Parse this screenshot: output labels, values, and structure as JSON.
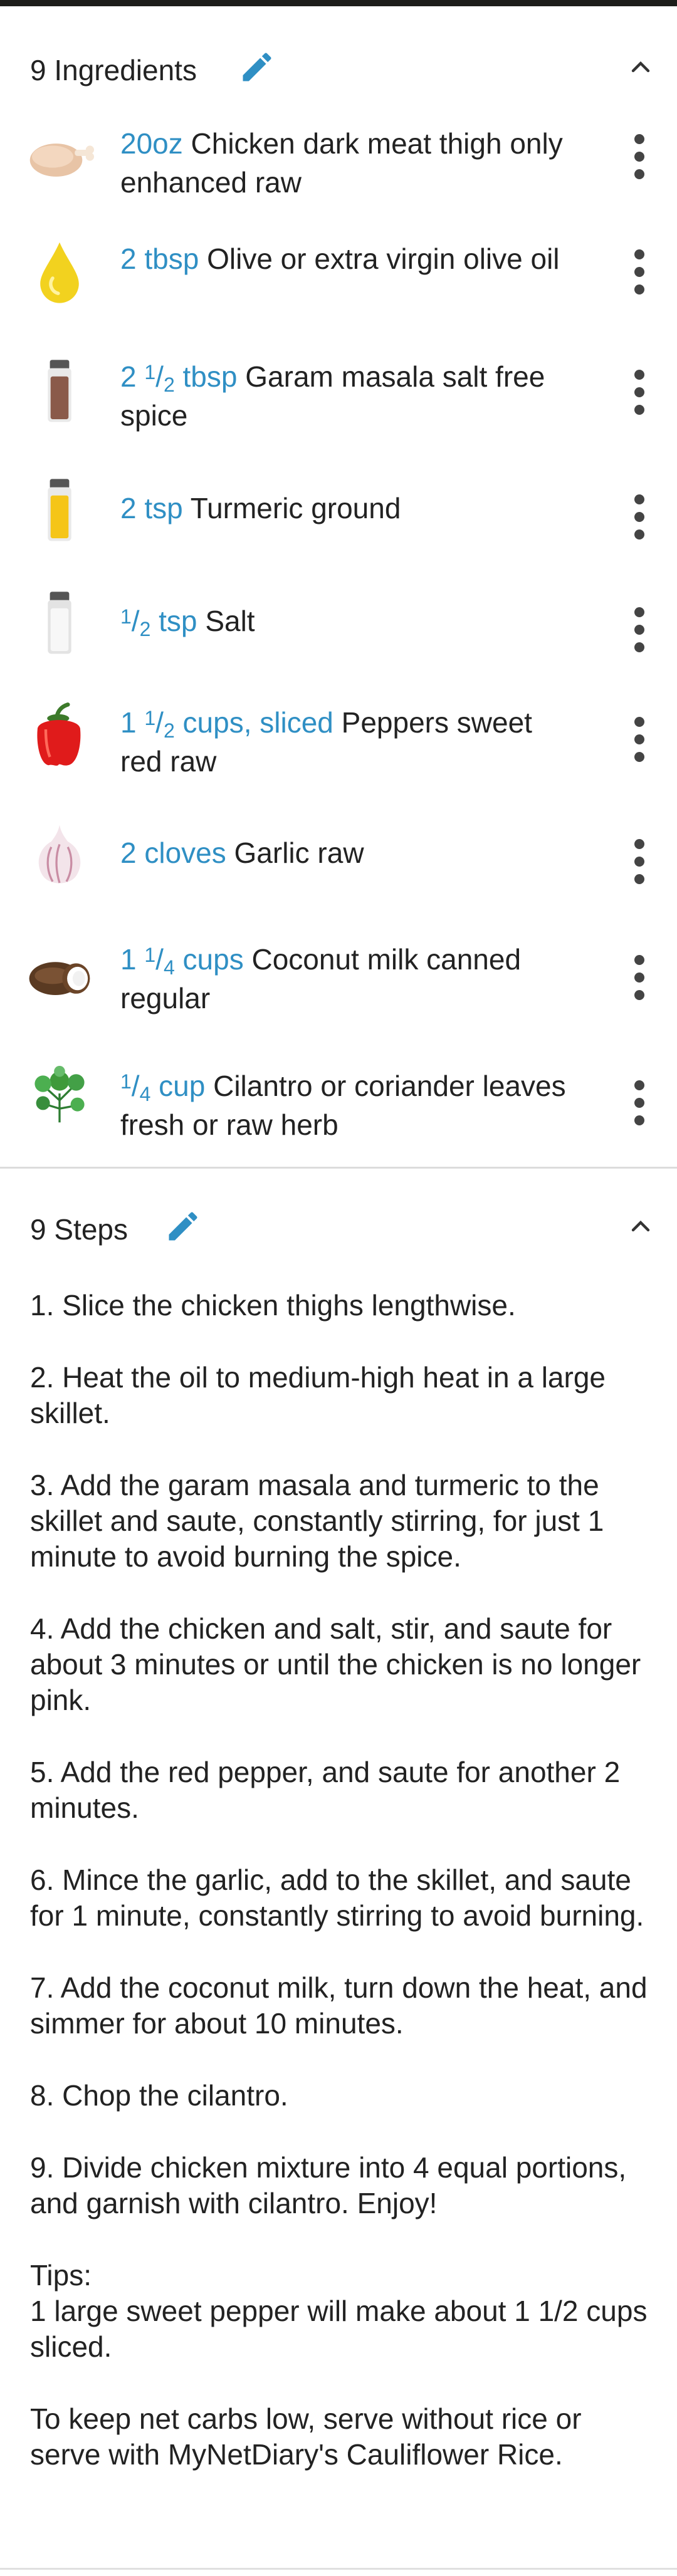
{
  "ingredients": {
    "title": "9 Ingredients",
    "items": [
      {
        "icon": "chicken-thigh-icon",
        "amount": "20oz",
        "name": "Chicken dark meat thigh only enhanced raw"
      },
      {
        "icon": "oil-drop-icon",
        "amount": "2 tbsp",
        "name": "Olive or extra virgin olive oil"
      },
      {
        "icon": "spice-jar-brown-icon",
        "amount_whole": "2",
        "amount_num": "1",
        "amount_den": "2",
        "amount_unit": "tbsp",
        "name": "Garam masala salt free spice"
      },
      {
        "icon": "spice-jar-yellow-icon",
        "amount": "2 tsp",
        "name": "Turmeric ground"
      },
      {
        "icon": "salt-shaker-icon",
        "amount_num": "1",
        "amount_den": "2",
        "amount_unit": "tsp",
        "name": "Salt"
      },
      {
        "icon": "red-pepper-icon",
        "amount_whole": "1",
        "amount_num": "1",
        "amount_den": "2",
        "amount_unit": "cups, sliced",
        "name": "Peppers sweet red raw"
      },
      {
        "icon": "garlic-icon",
        "amount": "2 cloves",
        "name": "Garlic raw"
      },
      {
        "icon": "coconut-icon",
        "amount_whole": "1",
        "amount_num": "1",
        "amount_den": "4",
        "amount_unit": "cups",
        "name": "Coconut milk canned regular"
      },
      {
        "icon": "cilantro-icon",
        "amount_num": "1",
        "amount_den": "4",
        "amount_unit": "cup",
        "name": "Cilantro or coriander leaves fresh or raw herb"
      }
    ]
  },
  "steps": {
    "title": "9 Steps",
    "items": [
      "1. Slice the chicken thighs lengthwise.",
      "2. Heat the oil to medium-high heat in a large skillet.",
      "3. Add the garam masala and turmeric to the skillet and saute, constantly stirring, for just 1 minute to avoid burning the spice.",
      "4. Add the chicken and salt, stir, and saute for about 3 minutes or until the chicken is no longer pink.",
      "5. Add the red pepper, and saute for another 2 minutes.",
      "6. Mince the garlic, add to the skillet, and saute for 1 minute, constantly stirring to avoid burning.",
      "7. Add the coconut milk, turn down the heat, and simmer for about 10 minutes.",
      "8. Chop the cilantro.",
      "9. Divide chicken mixture into 4 equal portions, and garnish with cilantro. Enjoy!"
    ],
    "tips_title": "Tips:",
    "tips": [
      "1 large sweet pepper will make about 1 1/2 cups sliced.",
      "To keep net carbs low, serve without rice or serve with MyNetDiary's Cauliflower Rice."
    ]
  },
  "colors": {
    "accent": "#2f8fc4",
    "divider": "#dcdcdc",
    "text": "#222222"
  }
}
